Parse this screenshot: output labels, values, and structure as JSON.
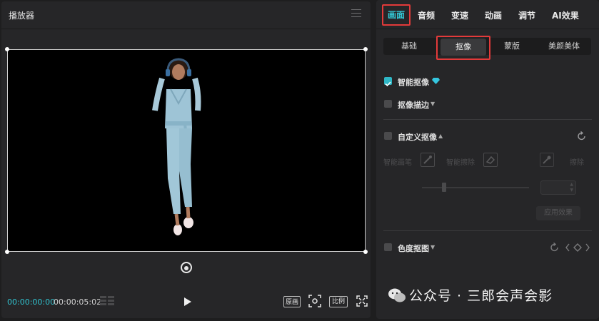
{
  "player": {
    "title": "播放器",
    "time_current": "00:00:00:00",
    "time_total": "00:00:05:02",
    "original_label": "原画",
    "ratio_label": "比例"
  },
  "inspector": {
    "tabs": [
      "画面",
      "音频",
      "变速",
      "动画",
      "调节",
      "AI效果"
    ],
    "active_tab": "画面",
    "subtabs": [
      "基础",
      "抠像",
      "蒙版",
      "美颜美体"
    ],
    "active_subtab": "抠像",
    "smart_cutout": {
      "label": "智能抠像",
      "checked": true
    },
    "cutout_stroke": {
      "label": "抠像描边",
      "checked": false
    },
    "custom_cutout": {
      "label": "自定义抠像",
      "checked": false
    },
    "custom_tools": [
      "智能画笔",
      "智能擦除",
      "擦除"
    ],
    "apply_label": "应用效果",
    "chroma_key": {
      "label": "色度抠图",
      "checked": false
    }
  },
  "watermark": "公众号 · 三郎会声会影",
  "colors": {
    "accent": "#33c9d6",
    "highlight_box": "#e33a3a"
  }
}
